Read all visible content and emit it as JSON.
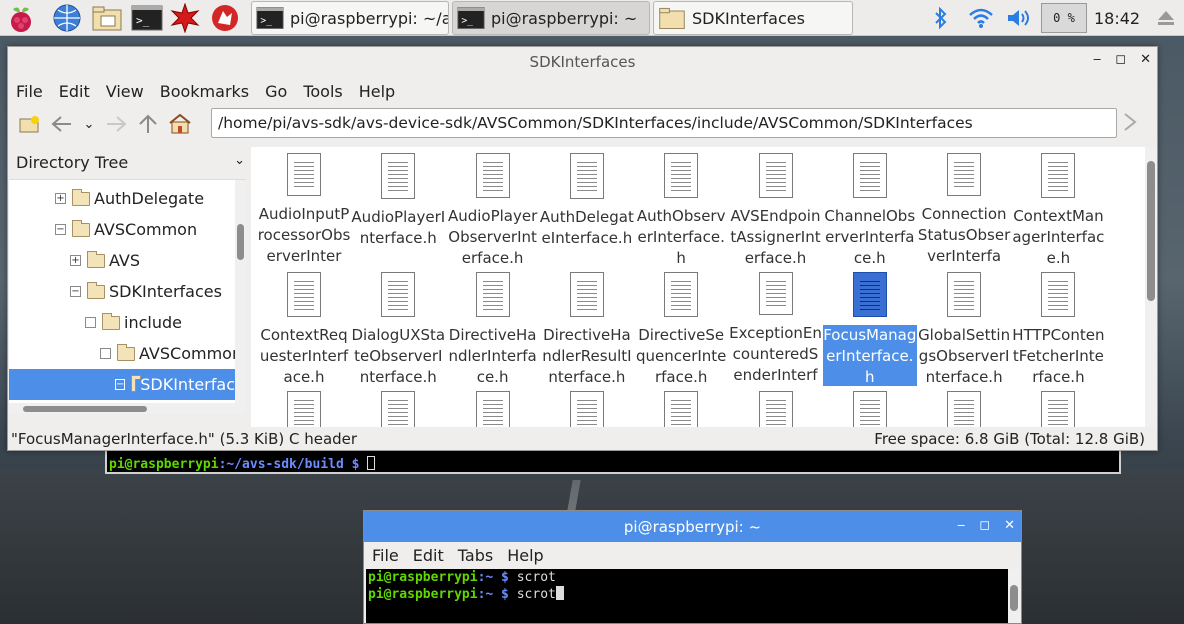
{
  "panel": {
    "tasks": [
      {
        "label": "pi@raspberrypi: ~/av…",
        "active": false
      },
      {
        "label": "pi@raspberrypi: ~",
        "active": true
      },
      {
        "label": "SDKInterfaces",
        "active": false
      }
    ],
    "cpu": "0 %",
    "clock": "18:42"
  },
  "file_manager": {
    "title": "SDKInterfaces",
    "menu": [
      "File",
      "Edit",
      "View",
      "Bookmarks",
      "Go",
      "Tools",
      "Help"
    ],
    "path": "/home/pi/avs-sdk/avs-device-sdk/AVSCommon/SDKInterfaces/include/AVSCommon/SDKInterfaces",
    "sidebar_title": "Directory Tree",
    "tree": [
      {
        "label": "AuthDelegate",
        "expander": "+"
      },
      {
        "label": "AVSCommon",
        "expander": "−"
      },
      {
        "label": "AVS",
        "expander": "+"
      },
      {
        "label": "SDKInterfaces",
        "expander": "−"
      },
      {
        "label": "include",
        "expander": ""
      },
      {
        "label": "AVSCommon",
        "expander": ""
      },
      {
        "label": "SDKInterfac",
        "expander": "−"
      }
    ],
    "files": [
      "AudioInputProcessorObserverInterf…",
      "AudioPlayerInterface.h",
      "AudioPlayerObserverInterface.h",
      "AuthDelegateInterface.h",
      "AuthObserverInterface.h",
      "AVSEndpointAssignerInterface.h",
      "ChannelObserverInterface.h",
      "ConnectionStatusObserverInterfac…",
      "ContextManagerInterface.h",
      "ContextRequesterInterface.h",
      "DialogUXStateObserverInterface.h",
      "DirectiveHandlerInterface.h",
      "DirectiveHandlerResultInterface.h",
      "DirectiveSequencerInterface.h",
      "ExceptionEncounteredSenderInterfa…",
      "FocusManagerInterface.h",
      "GlobalSettingsObserverInterface.h",
      "HTTPContentFetcherInterface.h"
    ],
    "selected_file": "FocusManagerInterface.h",
    "status_left": "\"FocusManagerInterface.h\" (5.3 KiB) C header",
    "status_right": "Free space: 6.8 GiB (Total: 12.8 GiB)"
  },
  "bg_terminal": {
    "prompt_user": "pi@raspberrypi",
    "prompt_path": ":~/avs-sdk/build $"
  },
  "terminal": {
    "title": "pi@raspberrypi: ~",
    "menu": [
      "File",
      "Edit",
      "Tabs",
      "Help"
    ],
    "lines": [
      {
        "user": "pi@raspberrypi",
        "path": ":~ $",
        "cmd": " scrot"
      },
      {
        "user": "pi@raspberrypi",
        "path": ":~ $",
        "cmd": " scrot"
      }
    ]
  },
  "colors": {
    "accent": "#4d8fe8",
    "prompt_user": "#5fd700",
    "prompt_path": "#6b8cff"
  }
}
